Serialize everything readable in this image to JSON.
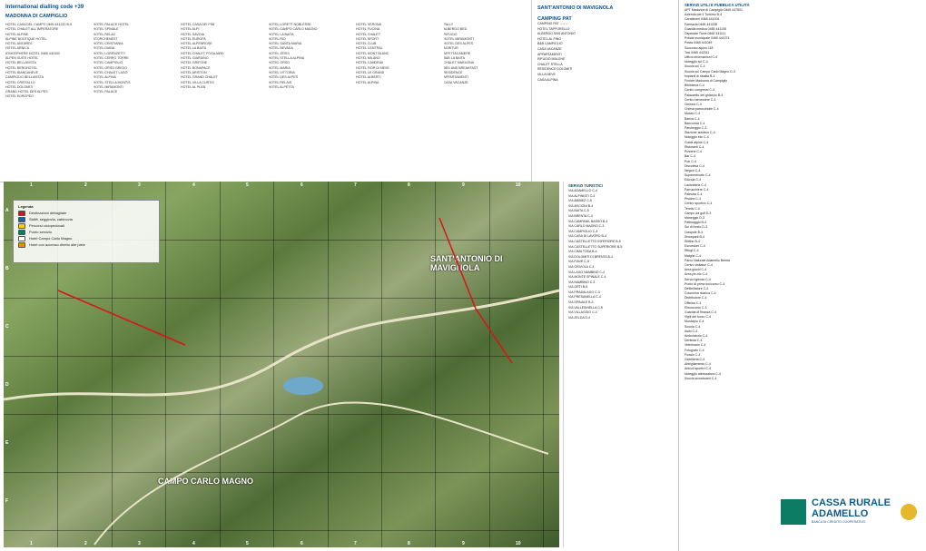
{
  "header": {
    "title": "International dialling code +39",
    "town_left": "MADONNA DI CAMPIGLIO",
    "town_right": "SANT'ANTONIO DI MAVIGNOLA"
  },
  "hotel_columns": [
    [
      "HOTEL CASA DEL CAMPO 0465 441220 B-5",
      "HOTEL CHALET ALL'IMPERATORE",
      "HOTEL ALPINE",
      "ALPINE BOUTIQUE HOTEL",
      "HOTEL ANTARES",
      "HOTEL ARNICA",
      "ATMOSPHERE HOTEL 0465 441530",
      "ALPEN SUITE HOTEL",
      "HOTEL BELLAVISTA",
      "HOTEL BERGHOTEL",
      "HOTEL BIANCANEVE",
      "CAMPIGLIO BELLAVISTA",
      "HOTEL CRISTALLO",
      "HOTEL DOLOMITI",
      "GRAND HOTEL DES ALPES",
      "HOTEL EUROPEO"
    ],
    [
      "HOTEL PALACE HOTEL",
      "HOTEL SPINALE",
      "HOTEL RELAX",
      "STORCHENEST",
      "HOTEL CRISTIANIA",
      "HOTEL DIANA",
      "HOTEL LORENZETTI",
      "HOTEL CERRO TORRE",
      "HOTEL CAMPIGLIO",
      "HOTEL ORSO GRIGIO",
      "HOTEL CHALET LAGO",
      "HOTEL ALPINA",
      "HOTEL STELLA MONTIS",
      "HOTEL MIRAMONTI",
      "HOTEL PALACE"
    ],
    [
      "HOTEL CASA DEI PINI",
      "HOTEL ALPI",
      "HOTEL SAVOIA",
      "HOTEL EUROPA",
      "HOTEL ALPENROSE",
      "HOTEL LA BAITA",
      "HOTEL CHALET FOGAJARD",
      "HOTEL GIARDINO",
      "HOTEL GRIFONE",
      "HOTEL BONAPACE",
      "HOTEL ARISTON",
      "HOTEL GRAND CHALET",
      "HOTEL VILLA CURTIS",
      "HOTEL AL PLAN"
    ],
    [
      "HOTEL LORETT NOBLESSE",
      "HOTEL CAMPO CARLO MAGNO",
      "HOTEL LA BAITA",
      "HOTEL RIO",
      "HOTEL SANTA MARIA",
      "HOTEL NEVADA",
      "HOTEL ZEISS",
      "HOTEL STELLA ALPINA",
      "HOTEL ORSO",
      "HOTEL MARIA",
      "HOTEL VITTORIA",
      "HOTEL DES ALPES",
      "HOTEL RELAIS",
      "HOTEL ALPETTA"
    ],
    [
      "HOTEL VERONA",
      "HOTEL FUCINA",
      "HOTEL CHALET",
      "HOTEL SPORT",
      "HOTEL CLUB",
      "HOTEL CENTRAL",
      "HOTEL MONT BLANC",
      "HOTEL MILANO",
      "HOTEL CANDRIAI",
      "HOTEL FIOR DI NEVE",
      "HOTEL LE GRAND",
      "HOTEL ALBERTI",
      "HOTEL ALPINA"
    ],
    [
      "PALLY",
      "ALBERGO BED",
      "RIFUGIO",
      "HOTEL MIRAMONTI",
      "HOTEL DES ALPES",
      "AGRITUR",
      "AFFITTACAMERE",
      "B&B LA BAITA",
      "CHALET MARILENA",
      "BED AND BREAKFAST",
      "RESIDENCE",
      "APPARTAMENTI",
      "CASA VACANZE"
    ]
  ],
  "mid_lists": {
    "header": "CAMPING PAT",
    "items": [
      "CAMPING PAT ☆☆☆",
      "HOTEL TAPPORELLO",
      "ALBERGO SAN ANTONIO",
      "HOTEL AL PINO",
      "B&B CAMPIGLIO",
      "CASA VACANZE",
      "APPARTAMENTI",
      "RIFUGIO MALGHE",
      "CHALET STELLA",
      "RESIDENCE DOLOMITI",
      "VILLA NEVE",
      "CASA ALPINA"
    ]
  },
  "map": {
    "columns": [
      "1",
      "2",
      "3",
      "4",
      "5",
      "6",
      "7",
      "8",
      "9",
      "10"
    ],
    "rows": [
      "A",
      "B",
      "C",
      "D",
      "E",
      "F"
    ],
    "place_primary": "SANT'ANTONIO DI MAVIGNOLA",
    "place_secondary": "CAMPO CARLO MAGNO",
    "legend_title": "Legenda",
    "legend_items": [
      {
        "label": "Destinazioni dettagliate",
        "color": "#d9141b"
      },
      {
        "label": "Skilift, seggiovia, cabinovia",
        "color": "#1a5fa8"
      },
      {
        "label": "Percorsi ciclopedonali",
        "color": "#ffd200"
      },
      {
        "label": "Punto servizio",
        "color": "#0b7c63"
      },
      {
        "label": "Hotel Campo Carlo Magno",
        "color": "#ffffff"
      },
      {
        "label": "Hotel con accesso diretto alle piste",
        "color": "#f08b00"
      }
    ]
  },
  "right_col": {
    "header": "SERVIZI TURISTICI",
    "items": [
      "VIA ADAMELLO C-4",
      "VIA ALPINISTI C-4",
      "VIA AMBIEZ C-5",
      "VIA ARCIONI B-4",
      "VIA BAITA C-5",
      "VIA BRENTA C-4",
      "VIA CAMPANIL BASSO B-4",
      "VIA CARLO MAGNO C-3",
      "VIA CAMPIGLIO C-4",
      "VIA CASA DI LAVORO B-4",
      "VIA CASTELLETTO INFERIORE B-5",
      "VIA CASTELLETTO SUPERIORE B-5",
      "VIA CIMA TOSA B-4",
      "VIA DOLOMITI DI BRENTA B-4",
      "VIA FIAVÈ C-5",
      "VIA GRIVOLA C-4",
      "VIA LAGO NAMBINO C-4",
      "VIA MONTE SPINALE C-4",
      "VIA NAMBINO C-3",
      "VIA ORTI B-5",
      "VIA PRADALAGO C-3",
      "VIA PRESANELLA C-4",
      "VIA SPINALE B-4",
      "VIA VALLESINELLA C-5",
      "VIA VILLAGGIO C-4",
      "VIA ZELDA D-4"
    ]
  },
  "far_col": {
    "header": "SERVIZI UTILI E PUBBLICA UTILITÀ",
    "items": [
      "APT Madonna di Campiglio 0465 447501",
      "Azienda per il Turismo B-4",
      "Carabinieri 0465 441004",
      "Farmacia 0465 441038",
      "Guardia medica 0465 441108",
      "Ospedale Tione 0465 331111",
      "Polizia municipale 0465 441074",
      "Posta 0465 441049",
      "Soccorso alpino 118",
      "Taxi 0465 442011",
      "Ufficio informazioni C-4",
      "Noleggio sci C-4",
      "Scuola sci C-4",
      "Scuola sci Campo Carlo Magno D-3",
      "Impianti di risalita B-4",
      "Funivie Madonna di Campiglio",
      "Biblioteca C-4",
      "Centro congressi C-4",
      "Palazzetto del ghiaccio B-4",
      "Centro benessere C-4",
      "Cinema C-4",
      "Chiesa parrocchiale C-4",
      "Museo C-4",
      "Banca C-4",
      "Bancomat C-4",
      "Parcheggio C-3",
      "Stazione autobus C-4",
      "Noleggio bici C-4",
      "Guide alpine C-4",
      "Ristoranti C-4",
      "Pizzerie C-4",
      "Bar C-4",
      "Pub C-4",
      "Discoteca C-4",
      "Negozi C-4",
      "Supermercato C-4",
      "Edicola C-4",
      "Lavanderia C-4",
      "Parrucchiere C-4",
      "Palestra C-4",
      "Piscina C-4",
      "Centro sportivo C-4",
      "Tennis C-4",
      "Campo da golf D-3",
      "Maneggio D-3",
      "Pattinaggio B-4",
      "Sci di fondo D-3",
      "Ciaspole B-4",
      "Snowpark B-4",
      "Slittino B-4",
      "Escursioni C-4",
      "Rifugi C-4",
      "Malghe C-4",
      "Parco Naturale Adamello Brenta",
      "Centro visitatori C-4",
      "Area giochi C-4",
      "Area pic-nic C-4",
      "Servizi igienici C-4",
      "Punto di primo soccorso C-4",
      "Defibrillatore C-4",
      "Colonnina ricarica C-4",
      "Distributore C-4",
      "Officina C-4",
      "Elisoccorso C-3",
      "Guardia di finanza C-4",
      "Vigili del fuoco C-4",
      "Municipio C-4",
      "Scuola C-4",
      "Asilo C-4",
      "Ambulatorio C-4",
      "Dentista C-4",
      "Veterinario C-4",
      "Fotografo C-4",
      "Fioraio C-4",
      "Gioielleria C-4",
      "Abbigliamento C-4",
      "Articoli sportivi C-4",
      "Noleggio attrezzatura C-4",
      "Scuola snowboard C-4"
    ]
  },
  "bank": {
    "name_line1": "CASSA RURALE",
    "name_line2": "ADAMELLO",
    "sub": "BANCA DI CREDITO COOPERATIVO",
    "brand_color": "#0b5a8a",
    "logo_color": "#0b7c63"
  }
}
